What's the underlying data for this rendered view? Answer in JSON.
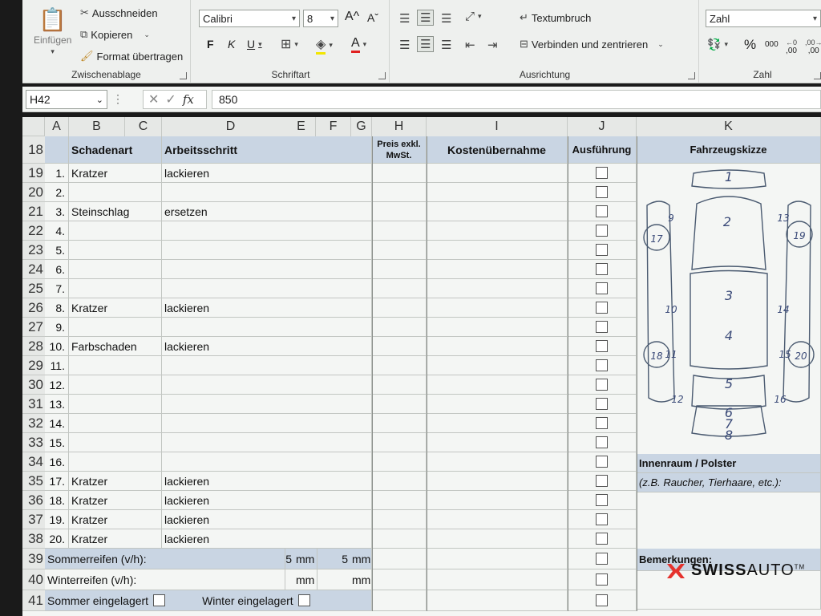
{
  "ribbon": {
    "clipboard": {
      "paste_label": "Einfügen",
      "cut_label": "Ausschneiden",
      "copy_label": "Kopieren",
      "format_painter_label": "Format übertragen",
      "group_label": "Zwischenablage"
    },
    "font": {
      "font_name": "Calibri",
      "font_size": "8",
      "grow_label": "A^",
      "shrink_label": "Aˇ",
      "bold_label": "F",
      "italic_label": "K",
      "underline_label": "U",
      "group_label": "Schriftart"
    },
    "alignment": {
      "wrap_text_label": "Textumbruch",
      "merge_center_label": "Verbinden und zentrieren",
      "group_label": "Ausrichtung"
    },
    "number": {
      "format_value": "Zahl",
      "percent_label": "%",
      "thousands_label": "000",
      "inc_decimal_label": ",00",
      "dec_decimal_label": ",00",
      "group_label": "Zahl"
    }
  },
  "formula_bar": {
    "name_box": "H42",
    "fx_label": "fx",
    "value": "850"
  },
  "columns": [
    "A",
    "B",
    "C",
    "D",
    "E",
    "F",
    "G",
    "H",
    "I",
    "J",
    "K"
  ],
  "header_row": {
    "row": "18",
    "schadenart": "Schadenart",
    "arbeitsschritt": "Arbeitsschritt",
    "preis_line1": "Preis exkl.",
    "preis_line2": "MwSt.",
    "kosten": "Kostenübernahme",
    "ausfuehrung": "Ausführung",
    "skizze": "Fahrzeugskizze"
  },
  "rows": [
    {
      "row": "19",
      "num": "1.",
      "schadenart": "Kratzer",
      "schritt": "lackieren"
    },
    {
      "row": "20",
      "num": "2.",
      "schadenart": "",
      "schritt": ""
    },
    {
      "row": "21",
      "num": "3.",
      "schadenart": "Steinschlag",
      "schritt": "ersetzen"
    },
    {
      "row": "22",
      "num": "4.",
      "schadenart": "",
      "schritt": ""
    },
    {
      "row": "23",
      "num": "5.",
      "schadenart": "",
      "schritt": ""
    },
    {
      "row": "24",
      "num": "6.",
      "schadenart": "",
      "schritt": ""
    },
    {
      "row": "25",
      "num": "7.",
      "schadenart": "",
      "schritt": ""
    },
    {
      "row": "26",
      "num": "8.",
      "schadenart": "Kratzer",
      "schritt": "lackieren"
    },
    {
      "row": "27",
      "num": "9.",
      "schadenart": "",
      "schritt": ""
    },
    {
      "row": "28",
      "num": "10.",
      "schadenart": "Farbschaden",
      "schritt": "lackieren"
    },
    {
      "row": "29",
      "num": "11.",
      "schadenart": "",
      "schritt": ""
    },
    {
      "row": "30",
      "num": "12.",
      "schadenart": "",
      "schritt": ""
    },
    {
      "row": "31",
      "num": "13.",
      "schadenart": "",
      "schritt": ""
    },
    {
      "row": "32",
      "num": "14.",
      "schadenart": "",
      "schritt": ""
    },
    {
      "row": "33",
      "num": "15.",
      "schadenart": "",
      "schritt": ""
    },
    {
      "row": "34",
      "num": "16.",
      "schadenart": "",
      "schritt": ""
    },
    {
      "row": "35",
      "num": "17.",
      "schadenart": "Kratzer",
      "schritt": "lackieren"
    },
    {
      "row": "36",
      "num": "18.",
      "schadenart": "Kratzer",
      "schritt": "lackieren"
    },
    {
      "row": "37",
      "num": "19.",
      "schadenart": "Kratzer",
      "schritt": "lackieren"
    },
    {
      "row": "38",
      "num": "20.",
      "schadenart": "Kratzer",
      "schritt": "lackieren"
    }
  ],
  "tires": {
    "summer_row": "39",
    "summer_label": "Sommerreifen (v/h):",
    "summer_front": "5",
    "summer_rear": "5",
    "winter_row": "40",
    "winter_label": "Winterreifen (v/h):",
    "winter_front": "",
    "winter_rear": "",
    "unit": "mm",
    "stored_row": "41",
    "summer_stored_label": "Sommer eingelagert",
    "winter_stored_label": "Winter eingelagert"
  },
  "side_panel": {
    "interior_title": "Innenraum / Polster",
    "interior_hint": "(z.B. Raucher, Tierhaare, etc.):",
    "remarks_title": "Bemerkungen:"
  },
  "sketch": {
    "zones": [
      "1",
      "2",
      "3",
      "4",
      "5",
      "6",
      "7",
      "8",
      "9",
      "10",
      "11",
      "12",
      "13",
      "14",
      "15",
      "16",
      "17",
      "18",
      "19",
      "20"
    ]
  },
  "watermark": {
    "brand_a": "SWISS",
    "brand_b": "AUTO",
    "tm": "TM",
    "brand_color": "#e5322d"
  }
}
